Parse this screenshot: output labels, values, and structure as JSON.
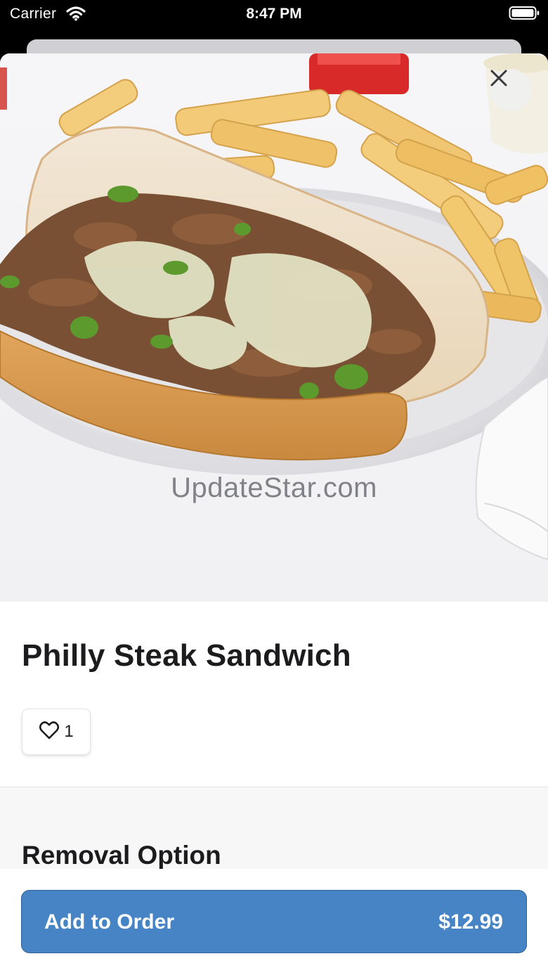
{
  "status_bar": {
    "carrier": "Carrier",
    "time": "8:47 PM",
    "icons": [
      "wifi-icon",
      "battery-icon"
    ]
  },
  "hero": {
    "image": "philly-steak-sandwich-photo",
    "watermark": "UpdateStar.com",
    "close_icon": "close-icon"
  },
  "item": {
    "title": "Philly Steak Sandwich",
    "likes": "1",
    "like_icon": "heart-outline-icon"
  },
  "options": {
    "section_title": "Removal Option"
  },
  "footer": {
    "button_label": "Add to Order",
    "price": "$12.99"
  },
  "colors": {
    "accent": "#4684c6",
    "title_text": "#1c1c1e",
    "options_background": "#f7f7f8"
  }
}
